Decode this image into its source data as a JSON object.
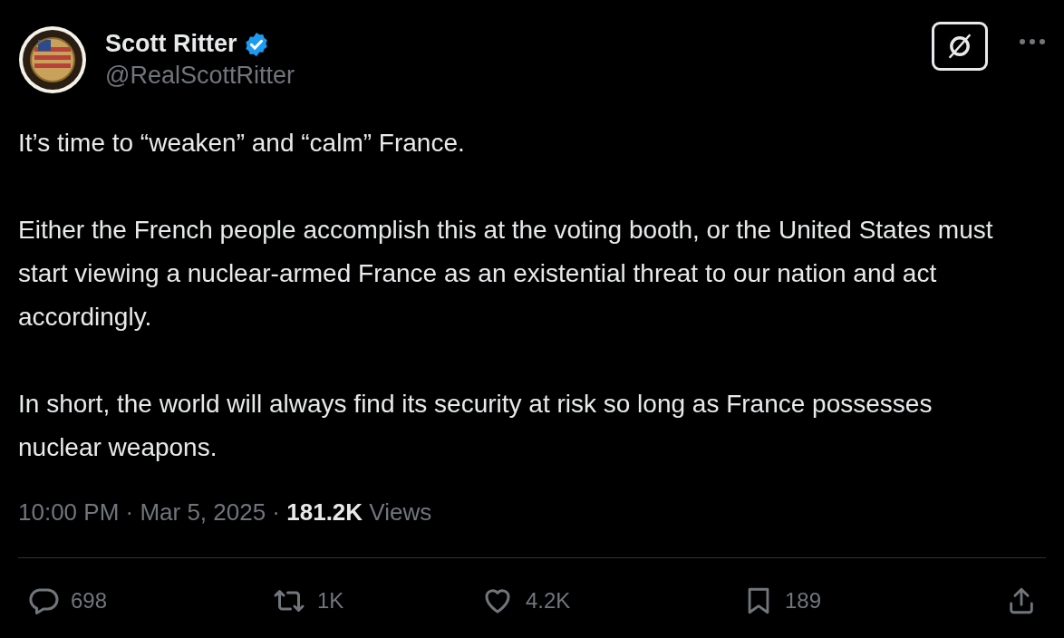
{
  "author": {
    "name": "Scott Ritter",
    "verified": true,
    "handle": "@RealScottRitter"
  },
  "paragraphs": [
    "It’s time to “weaken” and “calm” France.",
    "Either the French people accomplish this at the voting booth, or the United States must start viewing a nuclear-armed France as an existential threat to our nation and act accordingly.",
    "In short, the world will always find its security at risk so long as France possesses nuclear weapons."
  ],
  "meta": "10:00 PM · Mar 5, 2025 · **181.2K** Views",
  "actions": [
    {
      "kind": "reply",
      "count": "698"
    },
    {
      "kind": "repost",
      "count": "1K"
    },
    {
      "kind": "like",
      "count": "4.2K"
    },
    {
      "kind": "bookmark",
      "count": "189"
    },
    {
      "kind": "share"
    }
  ]
}
